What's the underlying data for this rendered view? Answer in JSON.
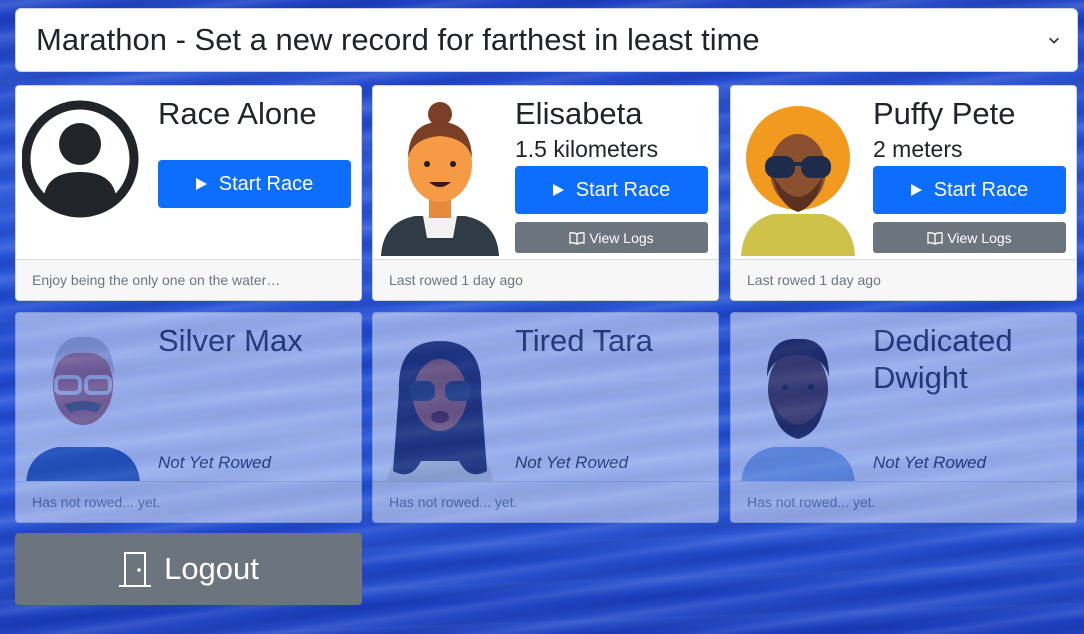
{
  "race_select": {
    "selected": "Marathon - Set a new record for farthest in least time"
  },
  "cards": [
    {
      "name": "Race Alone",
      "distance": "",
      "start_label": "Start Race",
      "logs_label": "",
      "status": "",
      "footer": "Enjoy being the only one on the water…",
      "avatar": "person-circle-icon"
    },
    {
      "name": "Elisabeta",
      "distance": "1.5 kilometers",
      "start_label": "Start Race",
      "logs_label": "View Logs",
      "status": "",
      "footer": "Last rowed 1 day ago",
      "avatar": "woman-bun-avatar"
    },
    {
      "name": "Puffy Pete",
      "distance": "2 meters",
      "start_label": "Start Race",
      "logs_label": "View Logs",
      "status": "",
      "footer": "Last rowed 1 day ago",
      "avatar": "afro-sunglasses-avatar"
    },
    {
      "name": "Silver Max",
      "distance": "",
      "start_label": "",
      "logs_label": "",
      "status": "Not Yet Rowed",
      "footer": "Has not rowed... yet.",
      "avatar": "gray-hair-glasses-avatar"
    },
    {
      "name": "Tired Tara",
      "distance": "",
      "start_label": "",
      "logs_label": "",
      "status": "Not Yet Rowed",
      "footer": "Has not rowed... yet.",
      "avatar": "curly-hair-sunglasses-avatar"
    },
    {
      "name": "Dedicated Dwight",
      "distance": "",
      "start_label": "",
      "logs_label": "",
      "status": "Not Yet Rowed",
      "footer": "Has not rowed... yet.",
      "avatar": "bearded-man-avatar"
    }
  ],
  "logout": {
    "label": "Logout"
  },
  "colors": {
    "primary": "#0d6efd",
    "secondary": "#6c757d"
  }
}
